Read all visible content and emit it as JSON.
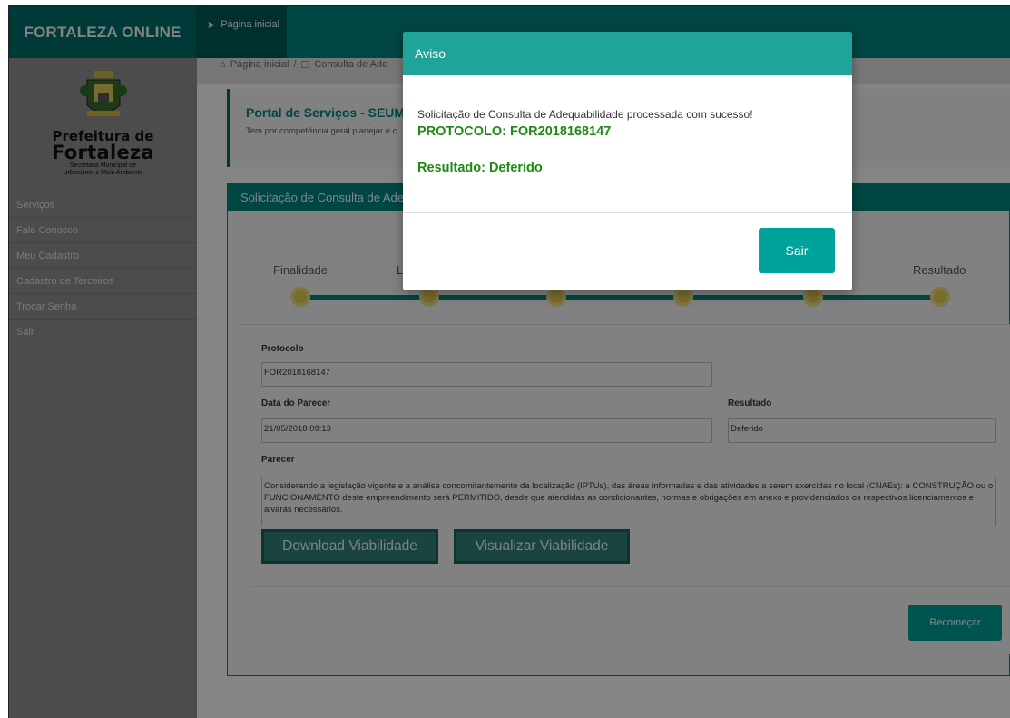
{
  "app": {
    "brand": "FORTALEZA ONLINE",
    "home_tab": "Página inicial"
  },
  "breadcrumb": {
    "home": "Página inicial",
    "separator": "/",
    "current": "Consulta de Ade"
  },
  "sidebar": {
    "logo": {
      "line1": "Prefeitura de",
      "line2": "Fortaleza",
      "line3": "Secretaria Municipal de",
      "line4": "Urbanismo e Meio Ambiente"
    },
    "items": [
      {
        "label": "Serviços"
      },
      {
        "label": "Fale Conosco"
      },
      {
        "label": "Meu Cadastro"
      },
      {
        "label": "Cadastro de Terceiros"
      },
      {
        "label": "Trocar Senha"
      },
      {
        "label": "Sair"
      }
    ]
  },
  "portal": {
    "title": "Portal de Serviços - SEUM",
    "desc": "Tem por competência geral planejar e c"
  },
  "panel": {
    "title": "Solicitação de Consulta de Ade",
    "steps": [
      "Finalidade",
      "L",
      "Resultado"
    ],
    "protocolo_label": "Protocolo",
    "protocolo_value": "FOR2018168147",
    "data_label": "Data do Parecer",
    "data_value": "21/05/2018 09:13",
    "resultado_label": "Resultado",
    "resultado_value": "Deferido",
    "parecer_label": "Parecer",
    "parecer_value": "Considerando a legislação vigente e a análise concomitantemente da localização (IPTUs), das áreas informadas e das atividades a serem exercidas no local (CNAEs): a CONSTRUÇÃO ou o FUNCIONAMENTO deste empreendimento será PERMITIDO, desde que atendidas as condicionantes, normas e obrigações em anexo e providenciados os respectivos licenciamentos e alvarás necessários.",
    "download_label": "Download Viabilidade",
    "visualizar_label": "Visualizar Viabilidade",
    "recomecar_label": "Recomeçar"
  },
  "modal": {
    "title": "Aviso",
    "message": "Solicitação de Consulta de Adequabilidade processada com sucesso!",
    "protocolo": "PROTOCOLO: FOR2018168147",
    "resultado": "Resultado: Deferido",
    "sair_label": "Sair"
  },
  "colors": {
    "primary": "#00807a",
    "modal_header": "#1fa49a",
    "success_text": "#1e8a13",
    "step_dot": "#dcc44a"
  },
  "icons": {
    "home_tab": "paper-plane-icon",
    "breadcrumb_home": "home-icon",
    "breadcrumb_page": "document-icon"
  }
}
